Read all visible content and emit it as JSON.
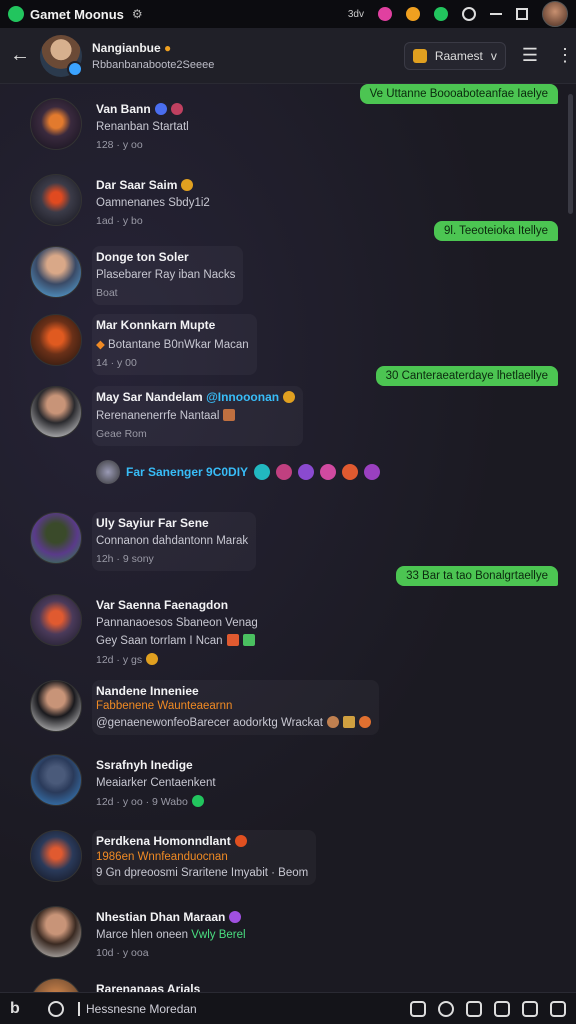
{
  "status_bar": {
    "app_title": "Gamet Moonus",
    "small_label": "3dv"
  },
  "header": {
    "name": "Nangianbue",
    "subtitle": "Rbbanbanaboote2Seeee",
    "badge_label": "Raamest",
    "badge_chevron": "v"
  },
  "messages": [
    {
      "name": "Van Bann",
      "line1": "Renanban Startatl",
      "meta": "128 · y oo"
    },
    {
      "name": "Dar Saar Saim",
      "line1": "Oamnenanes Sbdy1i2",
      "meta": "1ad · y bo"
    },
    {
      "name": "Donge ton Soler",
      "line1": "Plasebarer Ray iban Nacks",
      "line2": "Boat"
    },
    {
      "name": "Mar Konnkarn Mupte",
      "line1": "Botantane B0nWkar Macan",
      "meta": "14 · y 00"
    },
    {
      "name": "May Sar Nandelam",
      "name_tag": "@Innooonan",
      "line1": "Rerenanenerrfe Nantaal",
      "line2": "Geae Rom"
    },
    {
      "name": "Uly Sayiur Far Sene",
      "line1": "Connanon dahdantonn Marak",
      "meta": "12h · 9 sony"
    },
    {
      "name": "Var Saenna Faenagdon",
      "line1": "Pannanaoesos Sbaneon Venag",
      "line2": "Gey Saan torrlam I Ncan",
      "meta": "12d · y gs"
    },
    {
      "name": "Nandene Inneniee",
      "line1": "Fabbenene Waunteaearnn",
      "line2": "@genaenewonfeoBarecer aodorktg Wrackat"
    },
    {
      "name": "Ssrafnyh Inedige",
      "line1": "Meaiarker Centaenkent",
      "meta": "12d · y oo · 9 Wabo"
    },
    {
      "name": "Perdkena Homonndlant",
      "line1": "1986en Wnnfeanduocnan",
      "line2": "9 Gn dpreoosmi Sraritene Imyabit · Beom"
    },
    {
      "name": "Nhestian Dhan Maraan",
      "line1": "Marce hlen oneen",
      "line1b": "Vwly Berel",
      "meta": "10d · y ooa"
    },
    {
      "name": "Rarenanaas Arials"
    }
  ],
  "outgoing": [
    "Ve Uttanne Boooaboteanfae Iaelye",
    "9l. Teeoteioka Itellye",
    "30 Canteraeaterdaye lhetlaellye",
    "33 Bar ta tao Bonalgrtaellye"
  ],
  "reaction_row": {
    "label": "Far Sanenger 9C0DIY"
  },
  "composer": {
    "b_label": "b",
    "placeholder": "Hessnesne Moredan"
  }
}
